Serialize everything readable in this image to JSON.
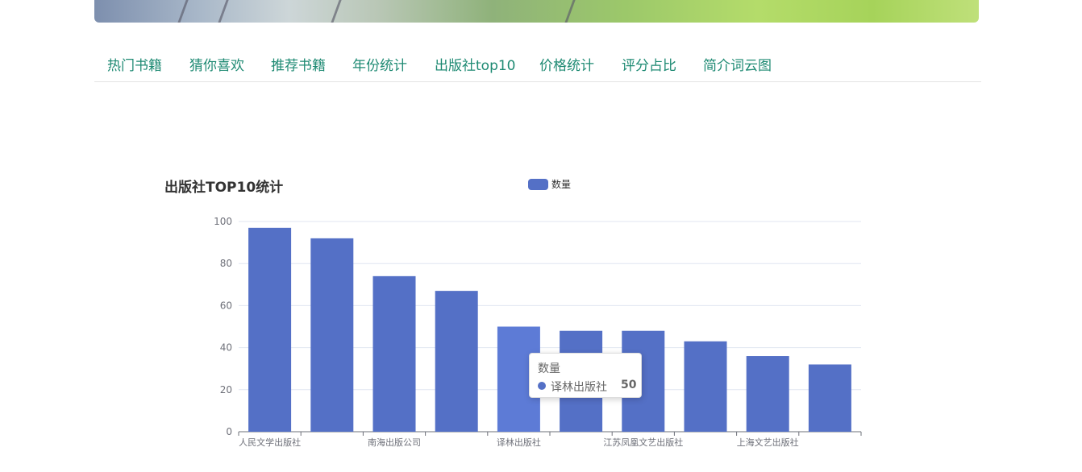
{
  "banner": {
    "description_icon": "landscape-banner-image"
  },
  "nav": {
    "items": [
      {
        "label": "热门书籍"
      },
      {
        "label": "猜你喜欢"
      },
      {
        "label": "推荐书籍"
      },
      {
        "label": "年份统计"
      },
      {
        "label": "出版社top10"
      },
      {
        "label": "价格统计"
      },
      {
        "label": "评分占比"
      },
      {
        "label": "简介词云图"
      }
    ],
    "color": "#1e8a73"
  },
  "chart_data": {
    "type": "bar",
    "title": "出版社TOP10统计",
    "legend": [
      "数量"
    ],
    "legend_position": "top",
    "categories": [
      "人民文学出版社",
      "",
      "南海出版公司",
      "",
      "译林出版社",
      "",
      "江苏凤凰文艺出版社",
      "",
      "上海文艺出版社",
      ""
    ],
    "series": [
      {
        "name": "数量",
        "values": [
          97,
          92,
          74,
          67,
          50,
          48,
          48,
          43,
          36,
          32
        ],
        "color": "#5470c6"
      }
    ],
    "ylim": [
      0,
      100
    ],
    "yticks": [
      0,
      20,
      40,
      60,
      80,
      100
    ],
    "grid": true,
    "tooltip": {
      "title": "数量",
      "name": "译林出版社",
      "value": "50"
    }
  }
}
